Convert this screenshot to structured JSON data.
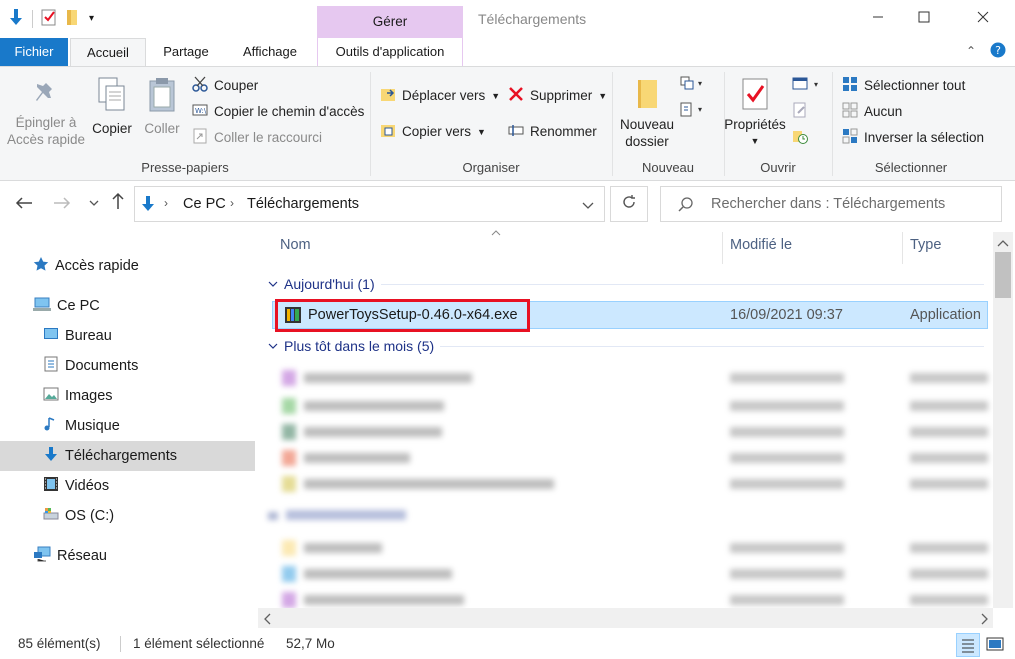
{
  "window": {
    "title": "Téléchargements",
    "context_tab_group": "Gérer"
  },
  "tabs": {
    "file": "Fichier",
    "home": "Accueil",
    "share": "Partage",
    "view": "Affichage",
    "app_tools": "Outils d'application"
  },
  "ribbon": {
    "clipboard": {
      "label": "Presse-papiers",
      "pin_line1": "Épingler à",
      "pin_line2": "Accès rapide",
      "copy": "Copier",
      "paste": "Coller",
      "cut": "Couper",
      "copy_path": "Copier le chemin d'accès",
      "paste_shortcut": "Coller le raccourci"
    },
    "organize": {
      "label": "Organiser",
      "move_to": "Déplacer vers",
      "copy_to": "Copier vers",
      "delete": "Supprimer",
      "rename": "Renommer"
    },
    "new": {
      "label": "Nouveau",
      "new_folder_line1": "Nouveau",
      "new_folder_line2": "dossier"
    },
    "open": {
      "label": "Ouvrir",
      "properties": "Propriétés"
    },
    "select": {
      "label": "Sélectionner",
      "select_all": "Sélectionner tout",
      "select_none": "Aucun",
      "invert": "Inverser la sélection"
    }
  },
  "address": {
    "crumb1": "Ce PC",
    "crumb2": "Téléchargements",
    "search_placeholder": "Rechercher dans : Téléchargements"
  },
  "nav": {
    "quick_access": "Accès rapide",
    "this_pc": "Ce PC",
    "desktop": "Bureau",
    "documents": "Documents",
    "pictures": "Images",
    "music": "Musique",
    "downloads": "Téléchargements",
    "videos": "Vidéos",
    "os": "OS (C:)",
    "network": "Réseau"
  },
  "list": {
    "columns": {
      "name": "Nom",
      "modified": "Modifié le",
      "type": "Type"
    },
    "group_today": "Aujourd'hui (1)",
    "group_earlier": "Plus tôt dans le mois (5)",
    "selected_file": {
      "name": "PowerToysSetup-0.46.0-x64.exe",
      "modified": "16/09/2021 09:37",
      "type": "Application"
    }
  },
  "status": {
    "count": "85 élément(s)",
    "selected": "1 élément sélectionné",
    "size": "52,7 Mo"
  },
  "colors": {
    "file_tab": "#1979ca",
    "selection": "#cce8ff",
    "highlight_box": "#e81123",
    "context_tab": "#e6c8f0"
  }
}
